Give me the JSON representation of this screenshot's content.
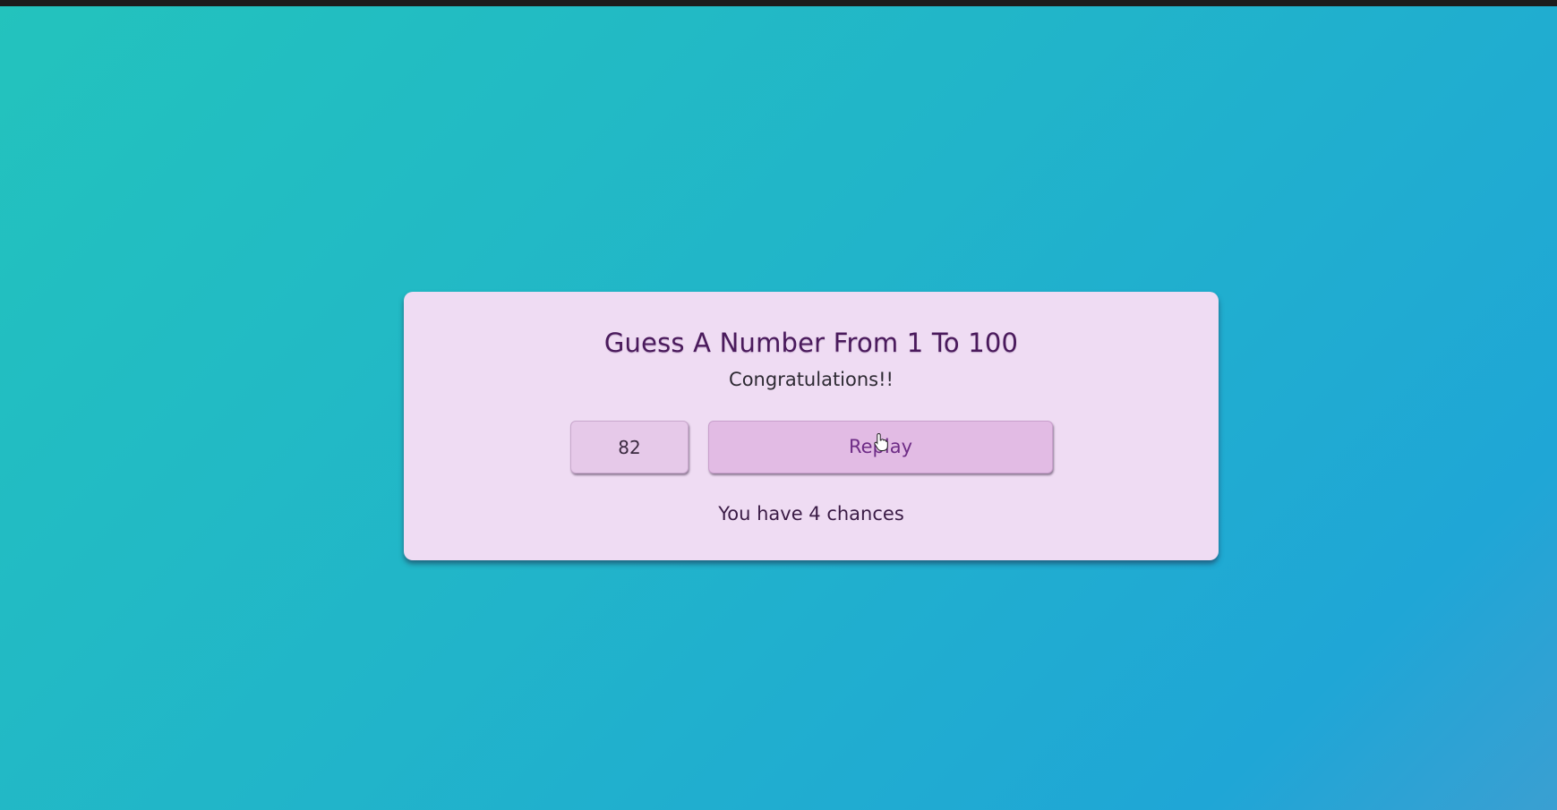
{
  "game": {
    "title": "Guess A Number From 1 To 100",
    "status": "Congratulations!!",
    "guess_value": "82",
    "replay_label": "Replay",
    "chances_text": "You have 4 chances"
  },
  "icons": {
    "cursor": "hand-pointer-icon"
  },
  "colors": {
    "card_background": "#efdcf3",
    "title_color": "#4a1a5c",
    "button_background": "#e2bbe4",
    "button_text": "#6e2c86",
    "background_start": "#23c3bd",
    "background_end": "#1fa6d6"
  }
}
